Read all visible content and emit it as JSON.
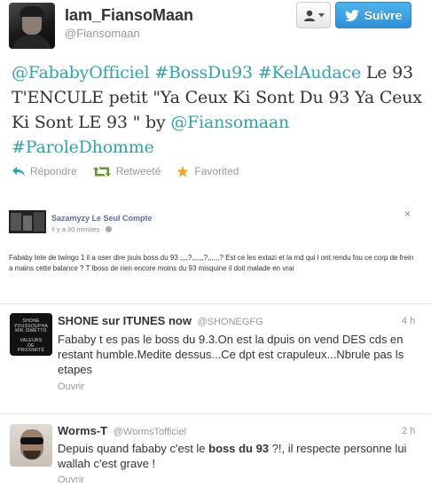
{
  "header": {
    "name": "Iam_FiansoMaan",
    "handle": "@Fiansomaan",
    "follow_label": "Suivre"
  },
  "tweet": {
    "segments": [
      {
        "text": "@FababyOfficiel",
        "link": true
      },
      {
        "text": " ",
        "link": false
      },
      {
        "text": "#BossDu93",
        "link": true
      },
      {
        "text": " ",
        "link": false
      },
      {
        "text": "#KelAudace",
        "link": true
      },
      {
        "text": " Le 93 T'ENCULE petit \"Ya Ceux Ki Sont Du 93 Ya Ceux Ki Sont LE 93 \" by ",
        "link": false
      },
      {
        "text": "@Fiansomaan",
        "link": true
      },
      {
        "text": " ",
        "link": false
      },
      {
        "text": "#ParoleDhomme",
        "link": true
      }
    ],
    "actions": {
      "reply": "Répondre",
      "retweet": "Retweeté",
      "favorite": "Favorited"
    },
    "colors": {
      "link": "#2fa4ab",
      "reply_icon": "#2fa4ab",
      "retweet_icon": "#609928",
      "favorite_icon": "#f5a623"
    }
  },
  "embedded": {
    "name": "Sazamyzy Le Seul Compte",
    "time": "Il y a 30 minutes · ",
    "text": "Fababy tete de twingo 1 il a oser dire jsuis boss du 93 ,,,,?,,,,,,?,,,,,,? Est ce les extazi et la md qui l ont rendu fou ce corp de frein a mains cette balance ? T lboss de rien encore moins du 93 misquine il doit malade en vrai",
    "close": "×"
  },
  "replies": [
    {
      "name": "SHONE sur ITUNES now",
      "handle": "@SHONEGFG",
      "time": "4 h",
      "avatar_lines": [
        "SHONE",
        "YOUSSOUPHA",
        "MIK ISMÉTTO",
        "",
        "VALEURS",
        "DE",
        "PROXIMITÉ"
      ],
      "text": "Fababy t es pas le boss du 9.3.On est la dpuis on vend DES cds en restant humble.Medite dessus...Ce dpt est crapuleux...Nbrule pas ls etapes",
      "open": "Ouvrir"
    },
    {
      "name": "Worms-T",
      "handle": "@WormsTofficiel",
      "time": "2 h",
      "text_before": "Depuis quand fababy c'est le ",
      "text_bold": "boss du 93",
      "text_after": " ?!, il respecte personne lui wallah c'est grave !",
      "open": "Ouvrir"
    }
  ]
}
